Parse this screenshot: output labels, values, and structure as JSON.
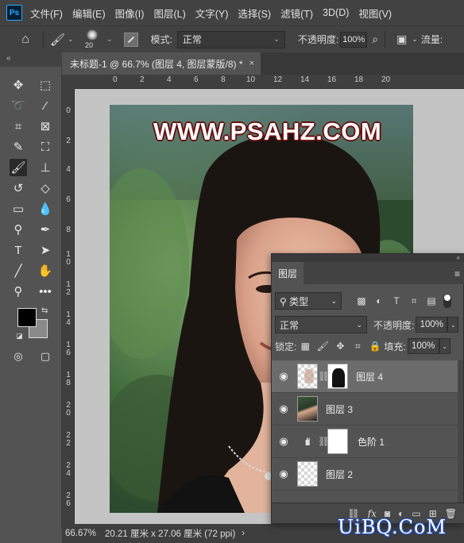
{
  "app": {
    "logo": "Ps"
  },
  "menu": [
    "文件(F)",
    "编辑(E)",
    "图像(I)",
    "图层(L)",
    "文字(Y)",
    "选择(S)",
    "滤镜(T)",
    "3D(D)",
    "视图(V)"
  ],
  "options": {
    "brush_size": "20",
    "mode_label": "模式:",
    "mode_value": "正常",
    "opacity_label": "不透明度:",
    "opacity_value": "100%",
    "flow_label": "流量:"
  },
  "tab": {
    "title": "未标题-1 @ 66.7% (图层 4, 图层蒙版/8) *",
    "close": "×"
  },
  "ruler": {
    "top": [
      "0",
      "2",
      "4",
      "6",
      "8",
      "10",
      "12",
      "14",
      "16",
      "18",
      "20"
    ],
    "left": [
      "0",
      "2",
      "4",
      "6",
      "8",
      "1\n0",
      "1\n2",
      "1\n4",
      "1\n6",
      "1\n8",
      "2\n0",
      "2\n2",
      "2\n4",
      "2\n6"
    ]
  },
  "canvas": {
    "watermark": "WWW.PSAHZ.COM"
  },
  "status": {
    "zoom": "66.67%",
    "doc_size": "20.21 厘米 x 27.06 厘米 (72 ppi)",
    "arrow": "›"
  },
  "site_logo": "UiBQ.CoM",
  "layers_panel": {
    "tab": "图层",
    "filter_label": "类型",
    "blend_mode": "正常",
    "opacity_label": "不透明度:",
    "opacity_value": "100%",
    "lock_label": "锁定:",
    "fill_label": "填充:",
    "fill_value": "100%",
    "layers": [
      {
        "name": "图层 4",
        "selected": true
      },
      {
        "name": "图层 3",
        "selected": false
      },
      {
        "name": "色阶 1",
        "selected": false
      },
      {
        "name": "图层 2",
        "selected": false
      }
    ]
  },
  "colors": {
    "foreground": "#000000",
    "background": "#8a8a8a",
    "accent": "#31a8ff"
  }
}
